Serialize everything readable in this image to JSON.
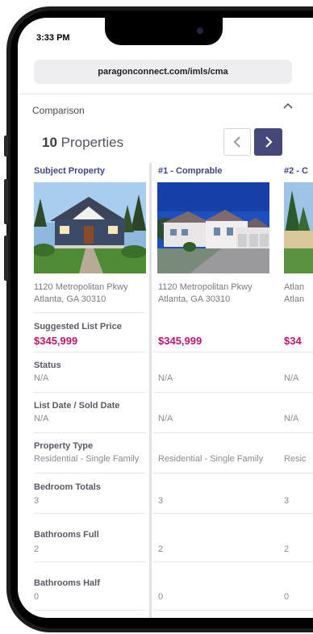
{
  "status_bar": {
    "time": "3:33 PM"
  },
  "browser": {
    "url": "paragonconnect.com/imls/cma"
  },
  "section": {
    "title": "Comparison"
  },
  "properties_summary": {
    "count": "10",
    "label": "Properties"
  },
  "columns": [
    {
      "header": "Subject Property",
      "address_line1": "1120 Metropolitan Pkwy",
      "address_line2": "Atlanta, GA 30310",
      "suggested_list_price": "$345,999",
      "status": "N/A",
      "list_sold_date": "N/A",
      "property_type": "Residential - Single Family",
      "bedroom_totals": "3",
      "bathrooms_full": "2",
      "bathrooms_half": "0"
    },
    {
      "header": "#1 - Comprable",
      "address_line1": "1120 Metropolitan Pkwy",
      "address_line2": "Atlanta, GA 30310",
      "suggested_list_price": "$345,999",
      "status": "N/A",
      "list_sold_date": "N/A",
      "property_type": "Residential - Single Family",
      "bedroom_totals": "3",
      "bathrooms_full": "2",
      "bathrooms_half": "0"
    },
    {
      "header": "#2 - C",
      "address_line1": "Atlan",
      "address_line2": "Atlan",
      "suggested_list_price": "$34",
      "status": "N/A",
      "list_sold_date": "N/A",
      "property_type": "Resic",
      "bedroom_totals": "3",
      "bathrooms_full": "2",
      "bathrooms_half": "0"
    }
  ],
  "field_labels": {
    "suggested_list_price": "Suggested List Price",
    "status": "Status",
    "list_sold_date": "List Date / Sold Date",
    "property_type": "Property Type",
    "bedroom_totals": "Bedroom Totals",
    "bathrooms_full": "Bathrooms Full",
    "bathrooms_half": "Bathrooms Half"
  },
  "colors": {
    "accent_navy": "#45497a",
    "header_text": "#3f4684",
    "price": "#c0166e"
  },
  "icons": [
    "chevron-up-icon",
    "chevron-left-icon",
    "chevron-right-icon"
  ]
}
